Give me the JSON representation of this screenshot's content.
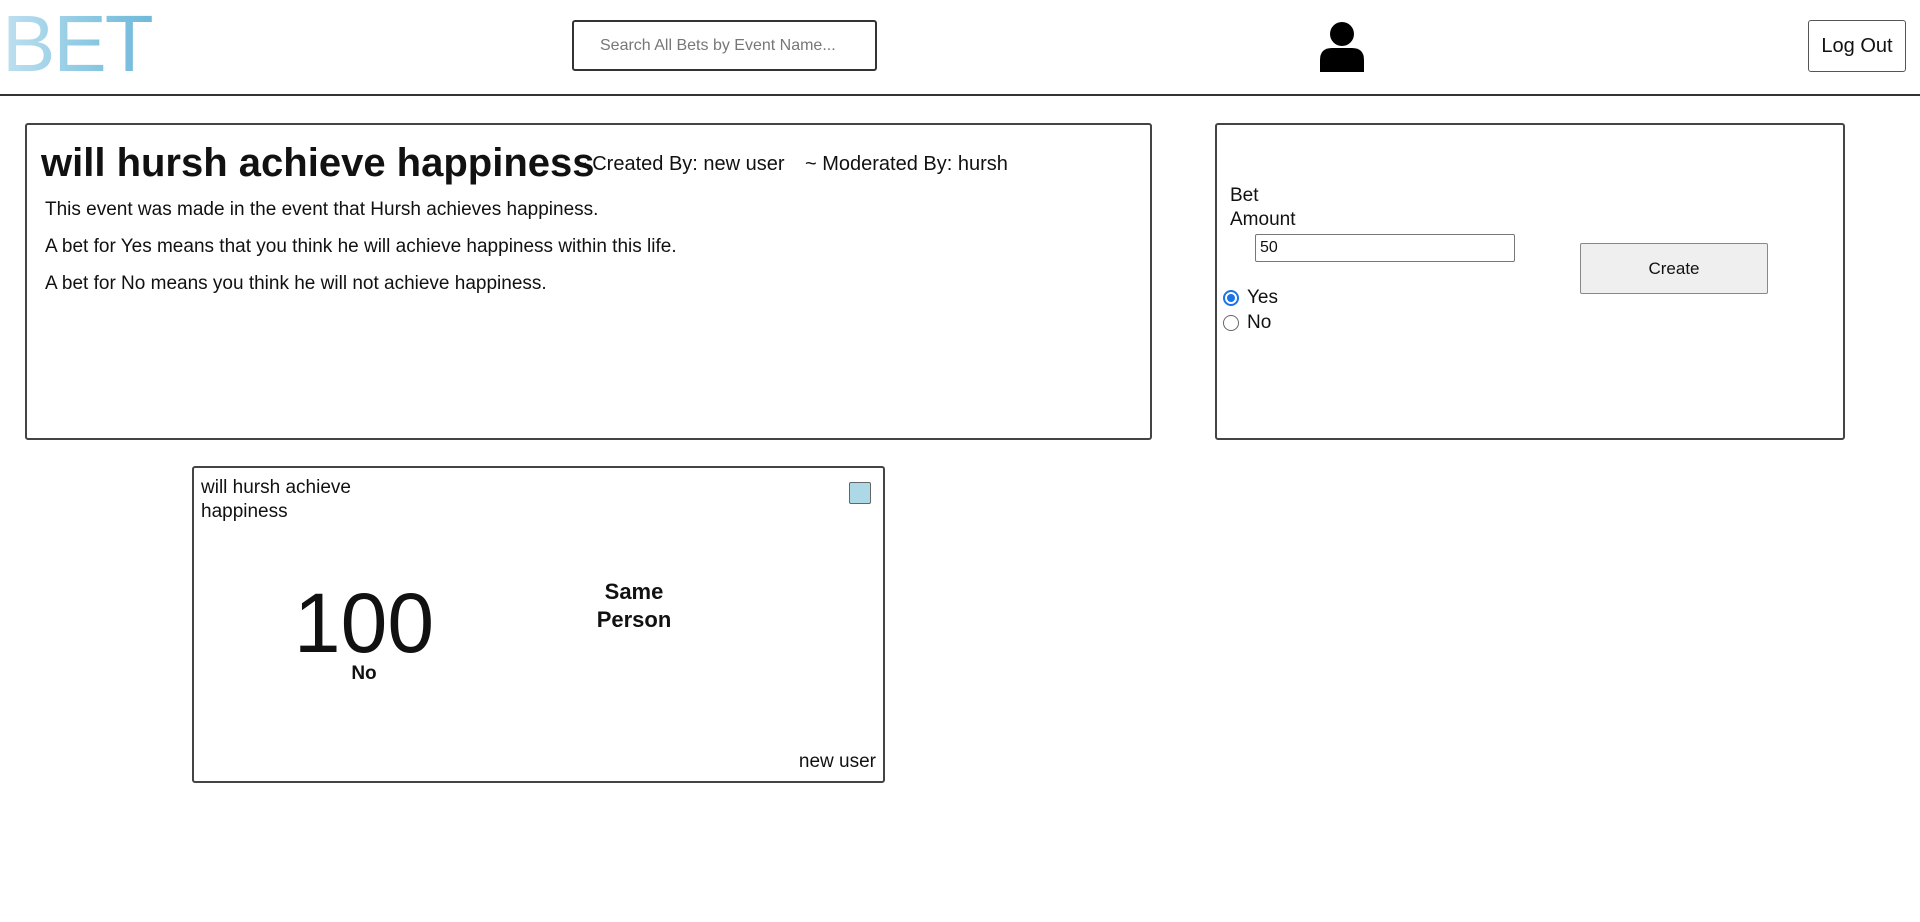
{
  "header": {
    "logo": "BET",
    "search_placeholder": "Search All Bets by Event Name...",
    "logout_label": "Log Out"
  },
  "event": {
    "title": "will hursh achieve happiness",
    "created_by": "~ Created By: new user",
    "moderated_by": "~ Moderated By: hursh",
    "description": [
      "This event was made in the event that Hursh achieves happiness.",
      "A bet for Yes means that you think he will achieve happiness within this life.",
      "A bet for No means you think he will not achieve happiness."
    ]
  },
  "bet_form": {
    "amount_label": "Bet Amount",
    "amount_value": "50",
    "options": [
      {
        "label": "Yes",
        "selected": true
      },
      {
        "label": "No",
        "selected": false
      }
    ],
    "create_label": "Create"
  },
  "bet_tile": {
    "title": "will hursh achieve happiness",
    "amount": "100",
    "choice": "No",
    "relation": "Same Person",
    "owner": "new user",
    "checkbox_color": "#add8e6"
  },
  "colors": {
    "logo_gradient_start": "#bfe0f0",
    "logo_gradient_end": "#6fb9db",
    "radio_accent": "#1a73e8"
  }
}
